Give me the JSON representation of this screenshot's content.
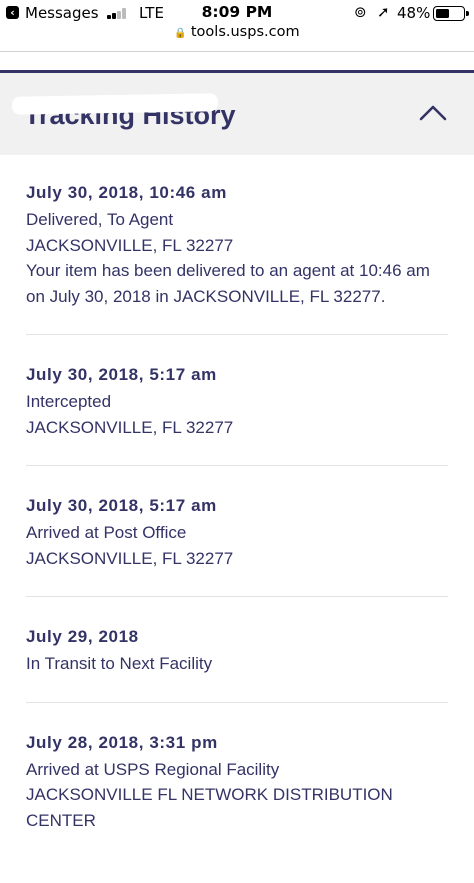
{
  "status_bar": {
    "back_app": "Messages",
    "network": "LTE",
    "time": "8:09 PM",
    "battery": "48%",
    "battery_level": 0.48
  },
  "browser": {
    "url": "tools.usps.com"
  },
  "panel": {
    "title": "Tracking History"
  },
  "events": [
    {
      "date": "July 30, 2018, 10:46 am",
      "status": "Delivered, To Agent",
      "location": "JACKSONVILLE, FL 32277",
      "details": "Your item has been delivered to an agent at 10:46 am on July 30, 2018 in JACKSONVILLE, FL 32277."
    },
    {
      "date": "July 30, 2018, 5:17 am",
      "status": "Intercepted",
      "location": "JACKSONVILLE, FL 32277"
    },
    {
      "date": "July 30, 2018, 5:17 am",
      "status": "Arrived at Post Office",
      "location": "JACKSONVILLE, FL 32277"
    },
    {
      "date": "July 29, 2018",
      "status": "In Transit to Next Facility"
    },
    {
      "date": "July 28, 2018, 3:31 pm",
      "status": "Arrived at USPS Regional Facility",
      "location": "JACKSONVILLE FL NETWORK DISTRIBUTION CENTER"
    }
  ],
  "icons": {
    "back": "back-arrow-icon",
    "signal": "cellular-signal-icon",
    "rotation_lock": "rotation-lock-icon",
    "location": "location-arrow-icon",
    "battery": "battery-icon",
    "secure": "lock-icon",
    "collapse": "chevron-up-icon"
  },
  "colors": {
    "brand": "#333366",
    "panel_bg": "#f1f1f1",
    "divider": "#e2e2e2"
  }
}
